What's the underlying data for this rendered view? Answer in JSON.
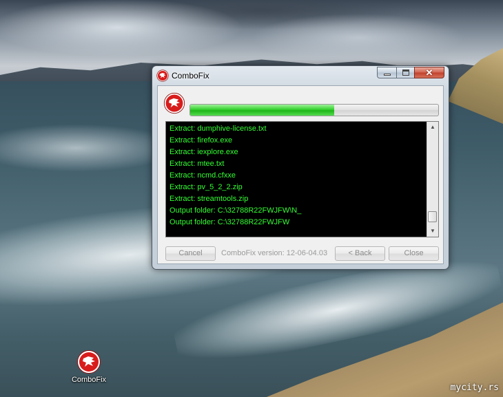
{
  "window": {
    "title": "ComboFix",
    "close_glyph": "✕"
  },
  "progress": {
    "fraction": 0.58
  },
  "log": {
    "lines": [
      "Extract: dumphive-license.txt",
      "Extract: firefox.exe",
      "Extract: iexplore.exe",
      "Extract: mtee.txt",
      "Extract: ncmd.cfxxe",
      "Extract: pv_5_2_2.zip",
      "Extract: streamtools.zip",
      "Output folder: C:\\32788R22FWJFW\\N_",
      "Output folder: C:\\32788R22FWJFW"
    ],
    "scroll_up": "▲",
    "scroll_down": "▼"
  },
  "buttons": {
    "cancel": "Cancel",
    "back": "< Back",
    "close": "Close"
  },
  "version_text": "ComboFix version: 12-06-04.03",
  "desktop": {
    "icon_label": "ComboFix",
    "watermark": "mycity.rs"
  },
  "icons": {
    "app": "combofix-dragon-icon"
  },
  "colors": {
    "log_text": "#33ff33",
    "progress": "#2ecc29",
    "logo_red": "#d81c1c"
  }
}
